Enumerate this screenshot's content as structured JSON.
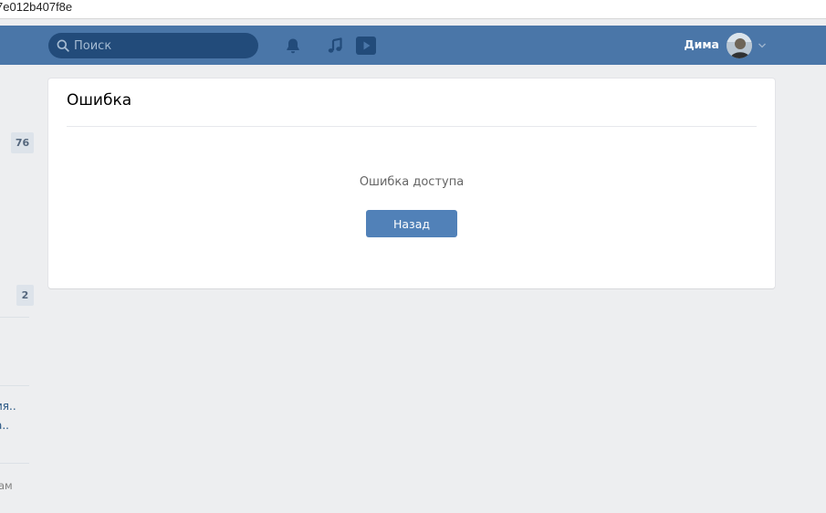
{
  "browser": {
    "url_fragment": "7e012b407f8e"
  },
  "header": {
    "search_placeholder": "Поиск",
    "user_name": "Дима",
    "icons": [
      "search-icon",
      "bell-icon",
      "music-icon",
      "video-play-icon",
      "chevron-down-icon"
    ],
    "colors": {
      "bar": "#4a76a8",
      "search_bg": "#224b7a"
    }
  },
  "sidebar": {
    "badges": [
      "76",
      "2"
    ],
    "items": [
      "ия..",
      "а..",
      "ам"
    ]
  },
  "panel": {
    "title": "Ошибка",
    "message": "Ошибка доступа",
    "back_label": "Назад"
  }
}
